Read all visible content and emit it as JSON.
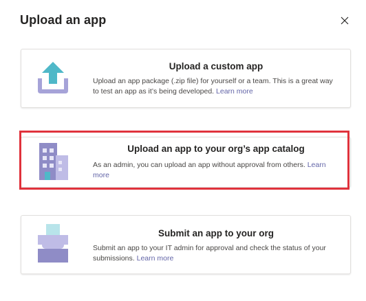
{
  "dialog": {
    "title": "Upload an app",
    "close_icon": "close-icon"
  },
  "options": [
    {
      "title": "Upload a custom app",
      "description": "Upload an app package (.zip file) for yourself or a team. This is a great way to test an app as it’s being developed.",
      "learn_more": "Learn more",
      "icon": "upload-arrow-icon"
    },
    {
      "title": "Upload an app to your org’s app catalog",
      "description": "As an admin, you can upload an app without approval from others.",
      "learn_more": "Learn more",
      "icon": "building-icon"
    },
    {
      "title": "Submit an app to your org",
      "description": "Submit an app to your IT admin for approval and check the status of your submissions.",
      "learn_more": "Learn more",
      "icon": "submit-tray-icon"
    }
  ],
  "colors": {
    "accent": "#6264a7",
    "highlight_border": "#e0323c",
    "icon_teal": "#4fb8c8",
    "icon_purple": "#a6a3d8"
  }
}
